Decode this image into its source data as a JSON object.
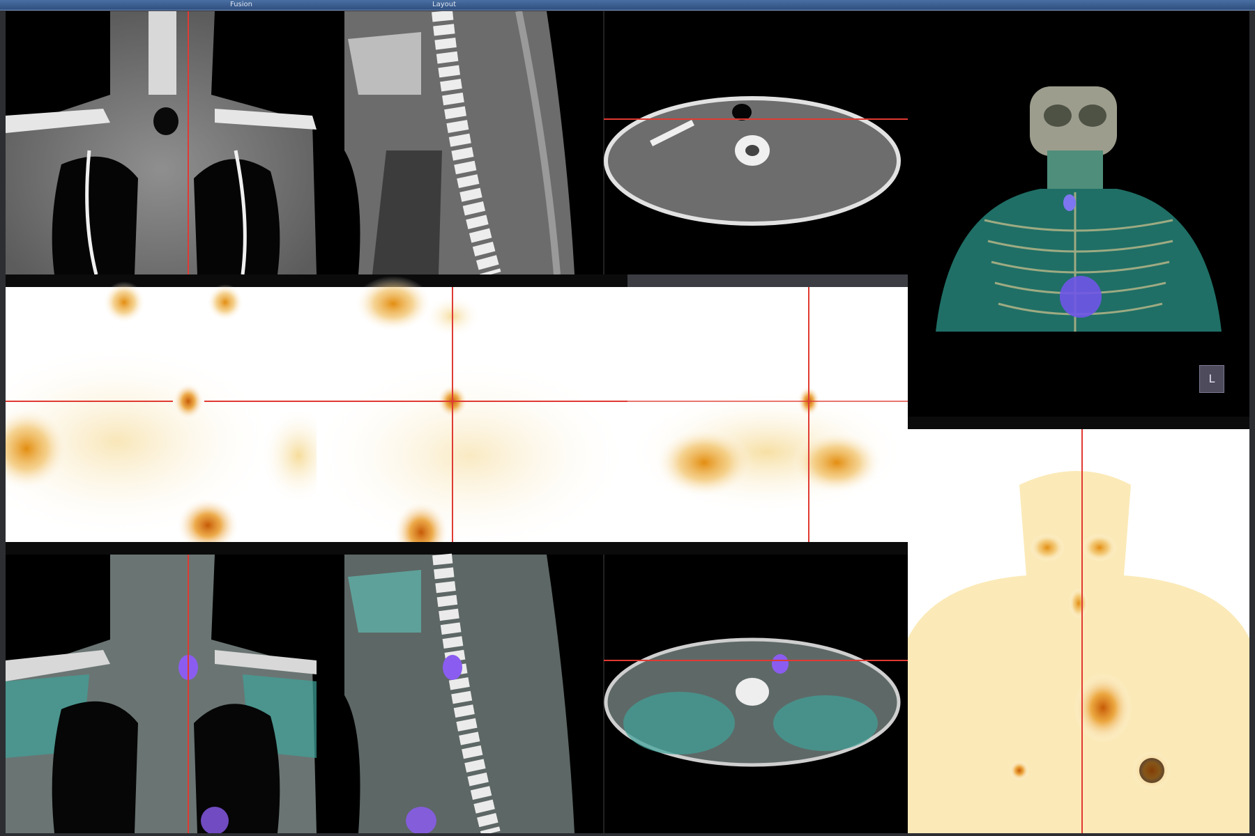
{
  "app": {
    "toolbar_labels": [
      "Fusion",
      "Layout"
    ]
  },
  "viewports": {
    "ct_coronal": {
      "overlay_tl": "",
      "overlay_bl": ""
    },
    "ct_sagittal": {
      "overlay_tl": "",
      "overlay_bl": ""
    },
    "ct_axial": {
      "overlay_tl": "",
      "overlay_bl": ""
    },
    "pet_coronal": {
      "header": "",
      "overlay_tl": "",
      "overlay_bl": ""
    },
    "pet_sagittal": {
      "header": "",
      "overlay_tl": "",
      "overlay_bl": ""
    },
    "pet_axial": {
      "header": "",
      "overlay_tl": "",
      "overlay_bl": ""
    },
    "fused_coronal": {
      "header": "",
      "overlay_tl": "",
      "overlay_bl": ""
    },
    "fused_sagittal": {
      "header": "",
      "overlay_tl": "",
      "overlay_bl": ""
    },
    "fused_axial": {
      "header": "",
      "overlay_tl": "",
      "overlay_bl": ""
    },
    "render_3d": {
      "overlay_bl": "",
      "orientation_button": "L",
      "header_below": ""
    },
    "mip": {
      "overlay_tl": ""
    }
  },
  "colors": {
    "crosshair": "#e03a32",
    "pet_hot": "#e89a20",
    "fusion_teal": "#3fa39a",
    "fusion_purple": "#8b5cf0"
  }
}
